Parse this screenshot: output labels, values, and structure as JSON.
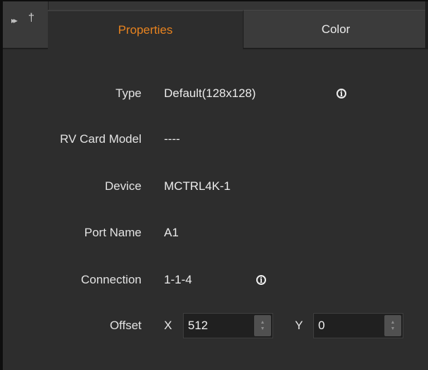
{
  "tabs": {
    "properties": "Properties",
    "color": "Color"
  },
  "fields": {
    "type": {
      "label": "Type",
      "value": "Default(128x128)"
    },
    "rv_card_model": {
      "label": "RV Card Model",
      "value": "----"
    },
    "device": {
      "label": "Device",
      "value": "MCTRL4K-1"
    },
    "port_name": {
      "label": "Port Name",
      "value": "A1"
    },
    "connection": {
      "label": "Connection",
      "value": "1-1-4"
    },
    "offset": {
      "label": "Offset",
      "x_label": "X",
      "x_value": "512",
      "y_label": "Y",
      "y_value": "0"
    }
  },
  "icons": {
    "info": "i",
    "collapse": "▸▸",
    "pin": "🖈"
  },
  "colors": {
    "active_tab_text": "#e8831f",
    "background": "#2d2d2d"
  }
}
